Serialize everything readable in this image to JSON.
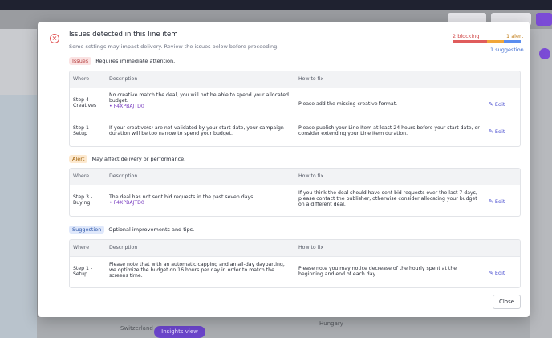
{
  "background": {
    "top_buttons": [
      "",
      "",
      ""
    ],
    "map_pill": "Insights view",
    "map_labels": [
      "Switzerland",
      "Hungary"
    ]
  },
  "modal": {
    "title": "Issues detected in this line item",
    "subtitle": "Some settings may impact delivery. Review the issues below before proceeding.",
    "stats": {
      "blocking": "2 blocking",
      "alert": "1 alert",
      "suggestion": "1 suggestion"
    },
    "colors": {
      "blocking": "#e05c5c",
      "alert": "#f0a63a",
      "suggestion": "#5b8def"
    },
    "columns": {
      "where": "Where",
      "description": "Description",
      "how": "How to fix"
    },
    "edit_label": "Edit",
    "close_label": "Close",
    "sections": {
      "issues": {
        "badge": "Issues",
        "desc": "Requires immediate attention.",
        "rows": [
          {
            "where": "Step 4 - Creatives",
            "description": "No creative match the deal, you will not be able to spend your allocated budget.",
            "code": "• F4XPBAJTD0",
            "fix": "Please add the missing creative format."
          },
          {
            "where": "Step 1 - Setup",
            "description": "If your creative(s) are not validated by your start date, your campaign duration will be too narrow to spend your budget.",
            "code": "",
            "fix": "Please publish your Line Item at least 24 hours before your start date, or consider extending your Line Item duration."
          }
        ]
      },
      "alert": {
        "badge": "Alert",
        "desc": "May affect delivery or performance.",
        "rows": [
          {
            "where": "Step 3 - Buying",
            "description": "The deal has not sent bid requests in the past seven days.",
            "code": "• F4XPBAJTD0",
            "fix": "If you think the deal should have sent bid requests over the last 7 days, please contact the publisher, otherwise consider allocating your budget on a different deal."
          }
        ]
      },
      "suggestion": {
        "badge": "Suggestion",
        "desc": "Optional improvements and tips.",
        "rows": [
          {
            "where": "Step 1 - Setup",
            "description": "Please note that with an automatic capping and an all-day dayparting, we optimize the budget on 16 hours per day in order to match the screens time.",
            "code": "",
            "fix": "Please note you may notice decrease of the hourly spent at the beginning and end of each day."
          }
        ]
      }
    }
  }
}
